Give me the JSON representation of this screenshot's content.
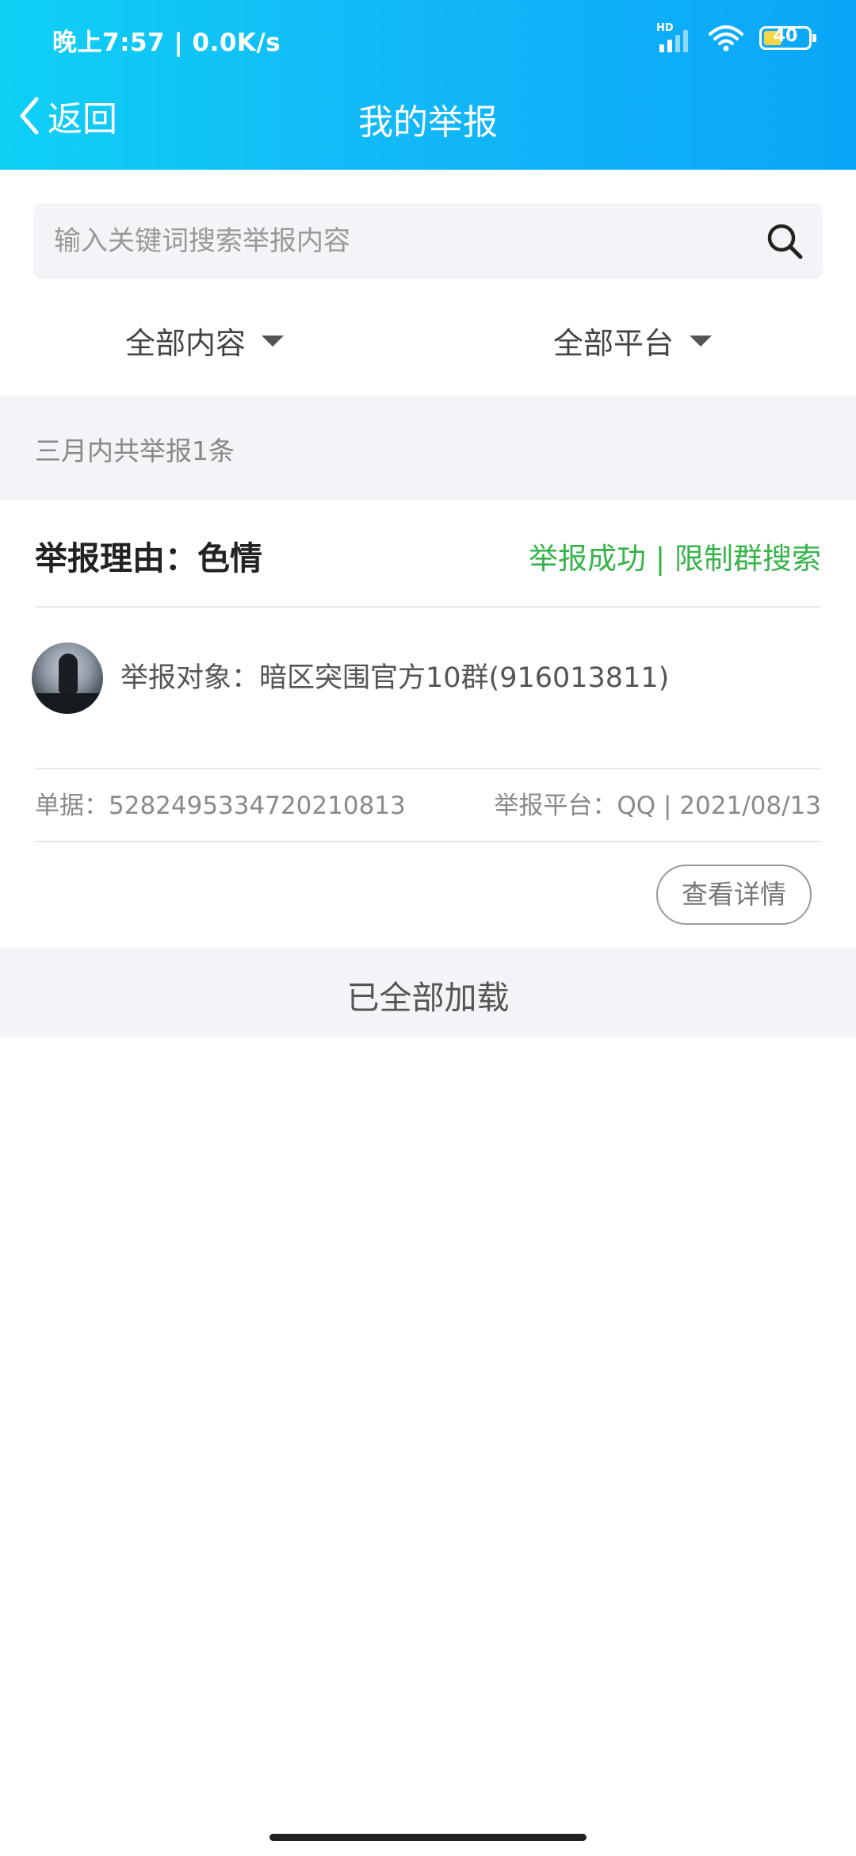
{
  "status_bar": {
    "time": "晚上7:57 | 0.0K/s",
    "network_badge": "HD",
    "battery_level": "40",
    "icons": [
      "signal-icon",
      "wifi-icon",
      "battery-icon"
    ]
  },
  "nav": {
    "back_label": "返回",
    "title": "我的举报"
  },
  "search": {
    "placeholder": "输入关键词搜索举报内容",
    "value": ""
  },
  "filters": {
    "content": "全部内容",
    "platform": "全部平台"
  },
  "summary": "三月内共举报1条",
  "reports": [
    {
      "reason": "举报理由：色情",
      "result": "举报成功 | 限制群搜索",
      "target": "举报对象：暗区突围官方10群(916013811)",
      "ticket": "单据：5282495334720210813",
      "platform": "举报平台：QQ | 2021/08/13",
      "detail_button": "查看详情"
    }
  ],
  "footer": {
    "loaded_text": "已全部加载"
  },
  "colors": {
    "header_gradient_start": "#0fd0f5",
    "header_gradient_end": "#0aa6f8",
    "success": "#37b34a",
    "band_background": "#f3f4f7"
  }
}
